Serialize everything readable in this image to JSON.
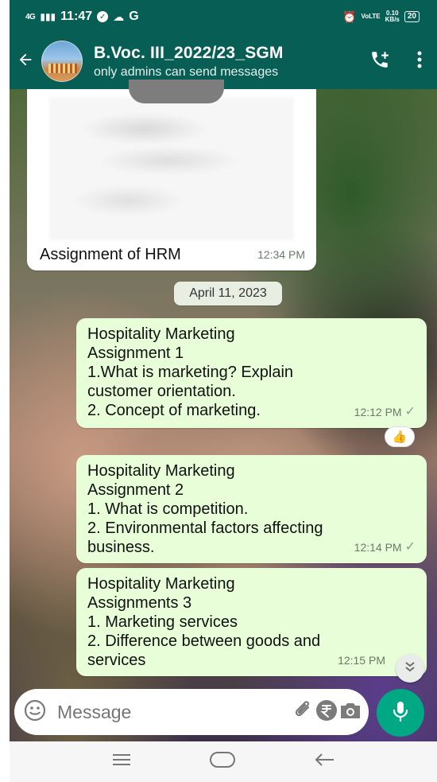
{
  "status_bar": {
    "network": "4G",
    "time": "11:47",
    "letter": "G",
    "volte_label": "VoLTE",
    "speed_value": "0.10",
    "speed_unit": "KB/s",
    "battery": "20"
  },
  "header": {
    "title": "B.Voc. III_2022/23_SGM",
    "subtitle": "only admins can send messages"
  },
  "messages": [
    {
      "type": "image",
      "direction": "in",
      "caption": "Assignment of HRM",
      "time": "12:34 PM"
    },
    {
      "type": "date",
      "text": "April 11, 2023"
    },
    {
      "type": "text",
      "direction": "out",
      "lines": [
        "Hospitality Marketing",
        "Assignment 1",
        "1.What is marketing? Explain",
        "customer orientation.",
        "2. Concept of marketing."
      ],
      "time": "12:12 PM",
      "status": "sent",
      "reaction": "👍"
    },
    {
      "type": "text",
      "direction": "out",
      "lines": [
        "Hospitality Marketing",
        "Assignment 2",
        "1. What is competition.",
        "2. Environmental factors affecting",
        "business."
      ],
      "time": "12:14 PM",
      "status": "sent"
    },
    {
      "type": "text",
      "direction": "out",
      "lines": [
        "Hospitality Marketing",
        "Assignments 3",
        "1. Marketing services",
        "2. Difference between goods and",
        "services"
      ],
      "time": "12:15 PM"
    }
  ],
  "input": {
    "placeholder": "Message"
  },
  "icons": {
    "back": "arrow-left-icon",
    "add_call": "add-call-icon",
    "menu": "more-vert-icon",
    "emoji": "emoji-icon",
    "attach": "paperclip-icon",
    "payment": "rupee-icon",
    "camera": "camera-icon",
    "mic": "microphone-icon"
  },
  "colors": {
    "header": "#075e54",
    "outgoing_bubble": "#e7fed8",
    "accent": "#00a884"
  }
}
